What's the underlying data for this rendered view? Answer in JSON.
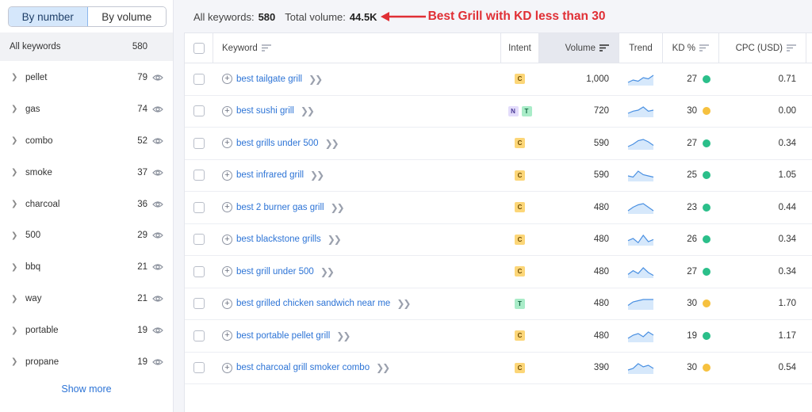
{
  "sidebar": {
    "toggle": {
      "by_number": "By number",
      "by_volume": "By volume"
    },
    "all_keywords": {
      "label": "All keywords",
      "count": "580"
    },
    "groups": [
      {
        "label": "pellet",
        "count": "79"
      },
      {
        "label": "gas",
        "count": "74"
      },
      {
        "label": "combo",
        "count": "52"
      },
      {
        "label": "smoke",
        "count": "37"
      },
      {
        "label": "charcoal",
        "count": "36"
      },
      {
        "label": "500",
        "count": "29"
      },
      {
        "label": "bbq",
        "count": "21"
      },
      {
        "label": "way",
        "count": "21"
      },
      {
        "label": "portable",
        "count": "19"
      },
      {
        "label": "propane",
        "count": "19"
      }
    ],
    "show_more": "Show more"
  },
  "summary": {
    "all_keywords_label": "All keywords:",
    "all_keywords_value": "580",
    "total_volume_label": "Total volume:",
    "total_volume_value": "44.5K"
  },
  "annotation": "Best Grill with KD less than 30",
  "table": {
    "headers": {
      "keyword": "Keyword",
      "intent": "Intent",
      "volume": "Volume",
      "trend": "Trend",
      "kd": "KD %",
      "cpc": "CPC (USD)"
    },
    "rows": [
      {
        "keyword": "best tailgate grill",
        "intent": [
          "C"
        ],
        "volume": "1,000",
        "trend": [
          2,
          4,
          3,
          6,
          5,
          8
        ],
        "kd": "27",
        "kd_color": "#2bbf8a",
        "cpc": "0.71"
      },
      {
        "keyword": "best sushi grill",
        "intent": [
          "N",
          "T"
        ],
        "volume": "720",
        "trend": [
          3,
          5,
          6,
          9,
          5,
          6
        ],
        "kd": "30",
        "kd_color": "#f6c13f",
        "cpc": "0.00"
      },
      {
        "keyword": "best grills under 500",
        "intent": [
          "C"
        ],
        "volume": "590",
        "trend": [
          2,
          4,
          7,
          8,
          6,
          3
        ],
        "kd": "27",
        "kd_color": "#2bbf8a",
        "cpc": "0.34"
      },
      {
        "keyword": "best infrared grill",
        "intent": [
          "C"
        ],
        "volume": "590",
        "trend": [
          4,
          3,
          8,
          5,
          4,
          3
        ],
        "kd": "25",
        "kd_color": "#2bbf8a",
        "cpc": "1.05"
      },
      {
        "keyword": "best 2 burner gas grill",
        "intent": [
          "C"
        ],
        "volume": "480",
        "trend": [
          2,
          5,
          7,
          8,
          5,
          2
        ],
        "kd": "23",
        "kd_color": "#2bbf8a",
        "cpc": "0.44"
      },
      {
        "keyword": "best blackstone grills",
        "intent": [
          "C"
        ],
        "volume": "480",
        "trend": [
          4,
          6,
          2,
          9,
          3,
          5
        ],
        "kd": "26",
        "kd_color": "#2bbf8a",
        "cpc": "0.34"
      },
      {
        "keyword": "best grill under 500",
        "intent": [
          "C"
        ],
        "volume": "480",
        "trend": [
          3,
          7,
          4,
          10,
          5,
          2
        ],
        "kd": "27",
        "kd_color": "#2bbf8a",
        "cpc": "0.34"
      },
      {
        "keyword": "best grilled chicken sandwich near me",
        "intent": [
          "T"
        ],
        "volume": "480",
        "trend": [
          3,
          6,
          7,
          8,
          8,
          8
        ],
        "kd": "30",
        "kd_color": "#f6c13f",
        "cpc": "1.70"
      },
      {
        "keyword": "best portable pellet grill",
        "intent": [
          "C"
        ],
        "volume": "480",
        "trend": [
          2,
          4,
          5,
          3,
          6,
          4
        ],
        "kd": "19",
        "kd_color": "#2bbf8a",
        "cpc": "1.17"
      },
      {
        "keyword": "best charcoal grill smoker combo",
        "intent": [
          "C"
        ],
        "volume": "390",
        "trend": [
          2,
          3,
          6,
          4,
          5,
          3
        ],
        "kd": "30",
        "kd_color": "#f6c13f",
        "cpc": "0.54"
      }
    ]
  }
}
